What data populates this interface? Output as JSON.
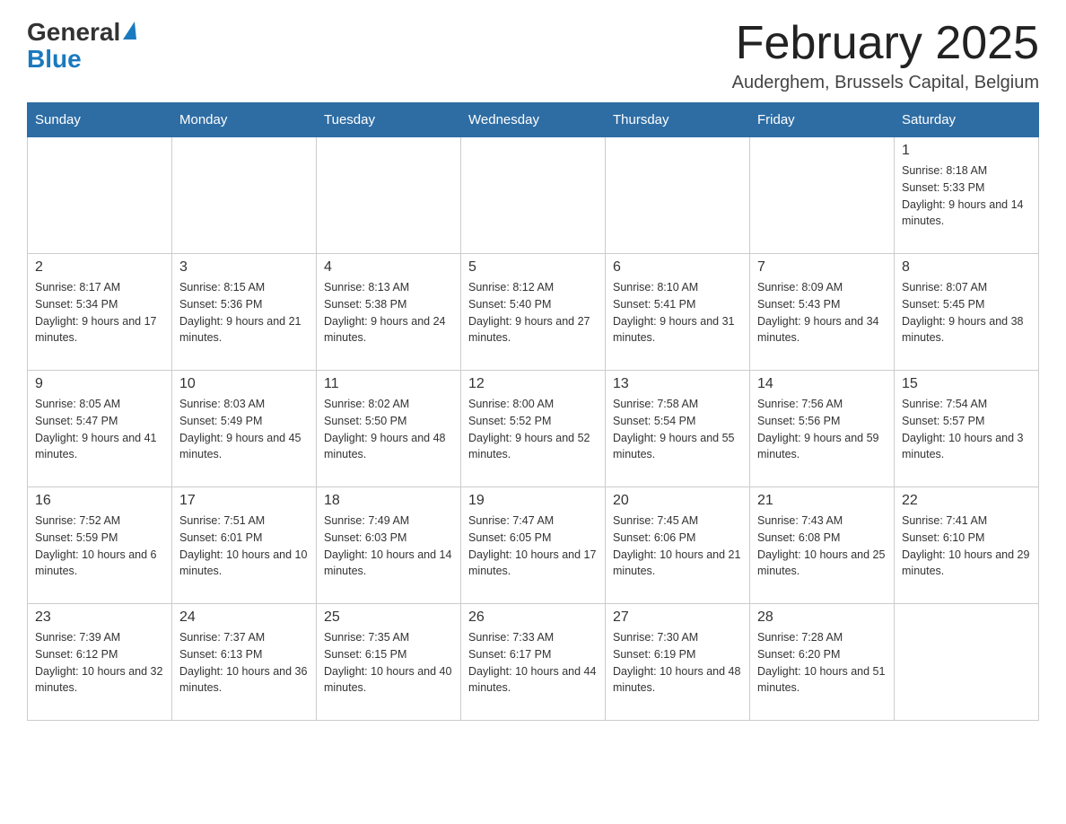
{
  "header": {
    "logo": {
      "general": "General",
      "triangle_symbol": "▶",
      "blue": "Blue"
    },
    "title": "February 2025",
    "location": "Auderghem, Brussels Capital, Belgium"
  },
  "calendar": {
    "days_of_week": [
      "Sunday",
      "Monday",
      "Tuesday",
      "Wednesday",
      "Thursday",
      "Friday",
      "Saturday"
    ],
    "weeks": [
      [
        {
          "day": "",
          "info": ""
        },
        {
          "day": "",
          "info": ""
        },
        {
          "day": "",
          "info": ""
        },
        {
          "day": "",
          "info": ""
        },
        {
          "day": "",
          "info": ""
        },
        {
          "day": "",
          "info": ""
        },
        {
          "day": "1",
          "info": "Sunrise: 8:18 AM\nSunset: 5:33 PM\nDaylight: 9 hours and 14 minutes."
        }
      ],
      [
        {
          "day": "2",
          "info": "Sunrise: 8:17 AM\nSunset: 5:34 PM\nDaylight: 9 hours and 17 minutes."
        },
        {
          "day": "3",
          "info": "Sunrise: 8:15 AM\nSunset: 5:36 PM\nDaylight: 9 hours and 21 minutes."
        },
        {
          "day": "4",
          "info": "Sunrise: 8:13 AM\nSunset: 5:38 PM\nDaylight: 9 hours and 24 minutes."
        },
        {
          "day": "5",
          "info": "Sunrise: 8:12 AM\nSunset: 5:40 PM\nDaylight: 9 hours and 27 minutes."
        },
        {
          "day": "6",
          "info": "Sunrise: 8:10 AM\nSunset: 5:41 PM\nDaylight: 9 hours and 31 minutes."
        },
        {
          "day": "7",
          "info": "Sunrise: 8:09 AM\nSunset: 5:43 PM\nDaylight: 9 hours and 34 minutes."
        },
        {
          "day": "8",
          "info": "Sunrise: 8:07 AM\nSunset: 5:45 PM\nDaylight: 9 hours and 38 minutes."
        }
      ],
      [
        {
          "day": "9",
          "info": "Sunrise: 8:05 AM\nSunset: 5:47 PM\nDaylight: 9 hours and 41 minutes."
        },
        {
          "day": "10",
          "info": "Sunrise: 8:03 AM\nSunset: 5:49 PM\nDaylight: 9 hours and 45 minutes."
        },
        {
          "day": "11",
          "info": "Sunrise: 8:02 AM\nSunset: 5:50 PM\nDaylight: 9 hours and 48 minutes."
        },
        {
          "day": "12",
          "info": "Sunrise: 8:00 AM\nSunset: 5:52 PM\nDaylight: 9 hours and 52 minutes."
        },
        {
          "day": "13",
          "info": "Sunrise: 7:58 AM\nSunset: 5:54 PM\nDaylight: 9 hours and 55 minutes."
        },
        {
          "day": "14",
          "info": "Sunrise: 7:56 AM\nSunset: 5:56 PM\nDaylight: 9 hours and 59 minutes."
        },
        {
          "day": "15",
          "info": "Sunrise: 7:54 AM\nSunset: 5:57 PM\nDaylight: 10 hours and 3 minutes."
        }
      ],
      [
        {
          "day": "16",
          "info": "Sunrise: 7:52 AM\nSunset: 5:59 PM\nDaylight: 10 hours and 6 minutes."
        },
        {
          "day": "17",
          "info": "Sunrise: 7:51 AM\nSunset: 6:01 PM\nDaylight: 10 hours and 10 minutes."
        },
        {
          "day": "18",
          "info": "Sunrise: 7:49 AM\nSunset: 6:03 PM\nDaylight: 10 hours and 14 minutes."
        },
        {
          "day": "19",
          "info": "Sunrise: 7:47 AM\nSunset: 6:05 PM\nDaylight: 10 hours and 17 minutes."
        },
        {
          "day": "20",
          "info": "Sunrise: 7:45 AM\nSunset: 6:06 PM\nDaylight: 10 hours and 21 minutes."
        },
        {
          "day": "21",
          "info": "Sunrise: 7:43 AM\nSunset: 6:08 PM\nDaylight: 10 hours and 25 minutes."
        },
        {
          "day": "22",
          "info": "Sunrise: 7:41 AM\nSunset: 6:10 PM\nDaylight: 10 hours and 29 minutes."
        }
      ],
      [
        {
          "day": "23",
          "info": "Sunrise: 7:39 AM\nSunset: 6:12 PM\nDaylight: 10 hours and 32 minutes."
        },
        {
          "day": "24",
          "info": "Sunrise: 7:37 AM\nSunset: 6:13 PM\nDaylight: 10 hours and 36 minutes."
        },
        {
          "day": "25",
          "info": "Sunrise: 7:35 AM\nSunset: 6:15 PM\nDaylight: 10 hours and 40 minutes."
        },
        {
          "day": "26",
          "info": "Sunrise: 7:33 AM\nSunset: 6:17 PM\nDaylight: 10 hours and 44 minutes."
        },
        {
          "day": "27",
          "info": "Sunrise: 7:30 AM\nSunset: 6:19 PM\nDaylight: 10 hours and 48 minutes."
        },
        {
          "day": "28",
          "info": "Sunrise: 7:28 AM\nSunset: 6:20 PM\nDaylight: 10 hours and 51 minutes."
        },
        {
          "day": "",
          "info": ""
        }
      ]
    ]
  }
}
